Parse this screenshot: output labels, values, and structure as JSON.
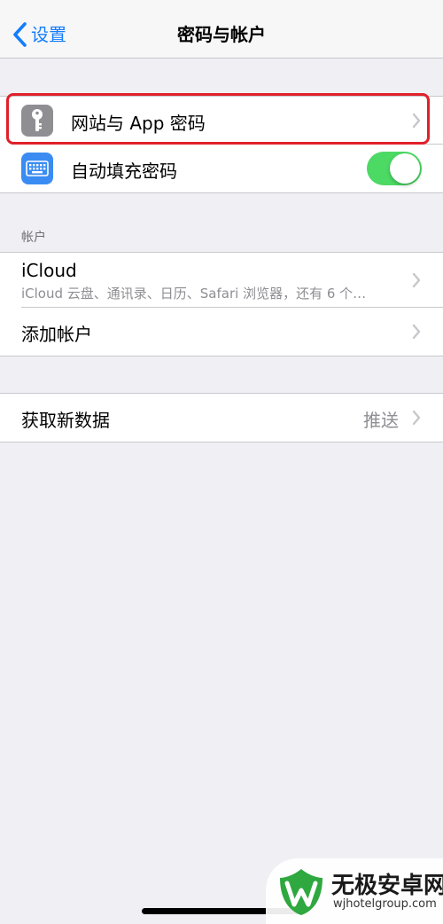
{
  "nav": {
    "back_label": "设置",
    "title": "密码与帐户"
  },
  "passwords_group": {
    "website_passwords_label": "网站与 App 密码",
    "autofill_label": "自动填充密码",
    "autofill_enabled": true
  },
  "accounts_section": {
    "header": "帐户",
    "icloud_title": "iCloud",
    "icloud_subtitle": "iCloud 云盘、通讯录、日历、Safari 浏览器，还有 6 个…",
    "add_account_label": "添加帐户"
  },
  "fetch_group": {
    "label": "获取新数据",
    "value": "推送"
  },
  "watermark": {
    "title": "无极安卓网",
    "url": "wjhotelgroup.com"
  },
  "colors": {
    "accent_blue": "#147efb",
    "toggle_green": "#4cd964",
    "highlight_red": "#e0202a",
    "background": "#efeff4"
  },
  "icons": {
    "back": "chevron-left-icon",
    "passwords": "key-icon",
    "autofill": "keyboard-icon",
    "disclosure": "chevron-right-icon"
  }
}
